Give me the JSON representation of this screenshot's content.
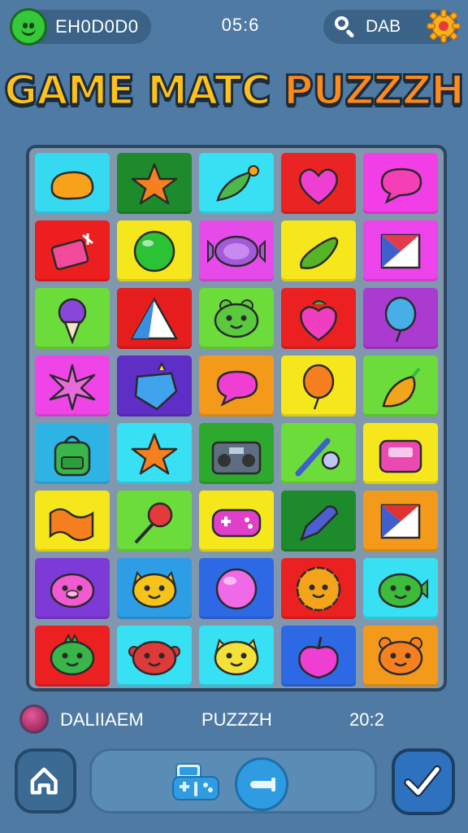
{
  "header": {
    "player_name": "EH0D0D0",
    "timer": "05:6",
    "right_label": "DAB"
  },
  "title": {
    "main": "GAME MATC",
    "accent": "PUZZZH"
  },
  "board": {
    "tiles": [
      {
        "bg": "#35d9f0",
        "icon": "blob-icon",
        "color": "#f7a21a"
      },
      {
        "bg": "#1d8a2c",
        "icon": "star-icon",
        "color": "#f6801f"
      },
      {
        "bg": "#37e0f3",
        "icon": "leaf-candy-icon",
        "color": "#4cb84a"
      },
      {
        "bg": "#ea2323",
        "icon": "heart-icon",
        "color": "#ef3fd2"
      },
      {
        "bg": "#f13ee7",
        "icon": "speech-bubble-icon",
        "color": "#f43fb5"
      },
      {
        "bg": "#ec1e1e",
        "icon": "gift-tag-icon",
        "color": "#f24a9a"
      },
      {
        "bg": "#f6e71d",
        "icon": "bubble-icon",
        "color": "#2bc235"
      },
      {
        "bg": "#e64be9",
        "icon": "candy-icon",
        "color": "#a359d8"
      },
      {
        "bg": "#f6e71d",
        "icon": "pickle-icon",
        "color": "#55b526"
      },
      {
        "bg": "#ec44ea",
        "icon": "flag-icon",
        "color": "#e23c4c"
      },
      {
        "bg": "#6bdc3a",
        "icon": "ice-cream-icon",
        "color": "#8847d8"
      },
      {
        "bg": "#e51d1d",
        "icon": "pyramid-icon",
        "color": "#3a8de0"
      },
      {
        "bg": "#6bdc3a",
        "icon": "frog-face-icon",
        "color": "#5ac93e"
      },
      {
        "bg": "#eb2020",
        "icon": "berry-icon",
        "color": "#ef3fc0"
      },
      {
        "bg": "#aa3ad0",
        "icon": "balloon-icon",
        "color": "#47aee8"
      },
      {
        "bg": "#ef45e8",
        "icon": "starburst-icon",
        "color": "#e76bdd"
      },
      {
        "bg": "#5f2ec6",
        "icon": "gem-icon",
        "color": "#3fa3ee"
      },
      {
        "bg": "#f39a1a",
        "icon": "speech-bubble-icon",
        "color": "#ef3fd2"
      },
      {
        "bg": "#f6e71d",
        "icon": "balloon-icon",
        "color": "#f6801f"
      },
      {
        "bg": "#6bdc3a",
        "icon": "pepper-icon",
        "color": "#f2a41c"
      },
      {
        "bg": "#2db4e5",
        "icon": "backpack-icon",
        "color": "#39b54a"
      },
      {
        "bg": "#37e0f3",
        "icon": "star-icon",
        "color": "#f6801f"
      },
      {
        "bg": "#2da92d",
        "icon": "boombox-icon",
        "color": "#5e6e80"
      },
      {
        "bg": "#6bdc3a",
        "icon": "wand-icon",
        "color": "#3f5fcf"
      },
      {
        "bg": "#f6e71d",
        "icon": "robot-face-icon",
        "color": "#ea4ab0"
      },
      {
        "bg": "#f6e71d",
        "icon": "wave-icon",
        "color": "#f6801f"
      },
      {
        "bg": "#6bdc3a",
        "icon": "lollipop-icon",
        "color": "#e43a3a"
      },
      {
        "bg": "#f6e71d",
        "icon": "gamepad-icon",
        "color": "#e040c9"
      },
      {
        "bg": "#1d8a2c",
        "icon": "crayon-icon",
        "color": "#4a5fd1"
      },
      {
        "bg": "#f39a1a",
        "icon": "flag-icon",
        "color": "#e13232"
      },
      {
        "bg": "#7d3ad6",
        "icon": "pig-face-icon",
        "color": "#f15ad0"
      },
      {
        "bg": "#2d9de5",
        "icon": "fox-face-icon",
        "color": "#f5c319"
      },
      {
        "bg": "#2d68e5",
        "icon": "orb-icon",
        "color": "#f06ae8"
      },
      {
        "bg": "#eb2020",
        "icon": "flower-face-icon",
        "color": "#f3a41b"
      },
      {
        "bg": "#37e0f3",
        "icon": "fish-face-icon",
        "color": "#3dbb3a"
      },
      {
        "bg": "#ec2020",
        "icon": "dino-face-icon",
        "color": "#39b54a"
      },
      {
        "bg": "#37e0f3",
        "icon": "crab-face-icon",
        "color": "#dd3a3a"
      },
      {
        "bg": "#37e0f3",
        "icon": "cat-face-icon",
        "color": "#f3e13a"
      },
      {
        "bg": "#2d68e5",
        "icon": "apple-icon",
        "color": "#ef3fd2"
      },
      {
        "bg": "#f39a1a",
        "icon": "bear-face-icon",
        "color": "#f6801f"
      }
    ]
  },
  "status": {
    "left": "DALIIAEM",
    "mid": "PUZZZH",
    "right": "20:2"
  },
  "bottom_bar": {
    "home_icon": "home-icon",
    "controller_icon": "controller-icon",
    "play_icon": "play-icon",
    "check_icon": "check-icon"
  }
}
